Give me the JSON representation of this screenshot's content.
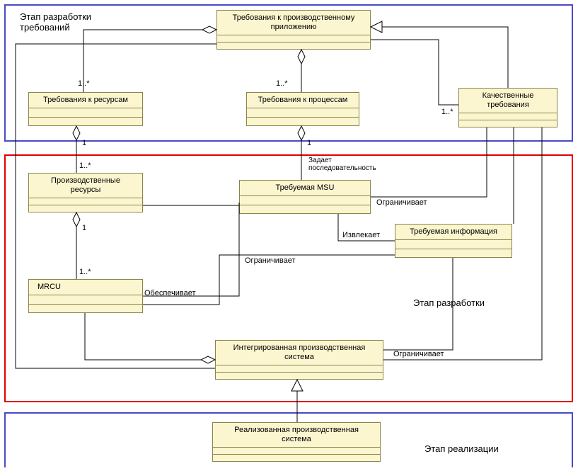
{
  "frames": {
    "requirements": {
      "title1": "Этап разработки",
      "title2": "требований"
    },
    "development": {
      "title": "Этап разработки"
    },
    "implementation": {
      "title": "Этап реализации"
    }
  },
  "classes": {
    "reqApp": {
      "title": "Требования к производственному\nприложению"
    },
    "reqRes": {
      "title": "Требования к ресурсам"
    },
    "reqProc": {
      "title": "Требования к процессам"
    },
    "qualReq": {
      "title": "Качественные\nтребования"
    },
    "prodRes": {
      "title": "Производственные\nресурсы"
    },
    "reqMSU": {
      "title": "Требуемая MSU"
    },
    "reqInfo": {
      "title": "Требуемая информация"
    },
    "mrcu": {
      "title": "MRCU"
    },
    "intSys": {
      "title": "Интегрированная производственная\nсистема"
    },
    "implSys": {
      "title": "Реализованная производственная\nсистема"
    }
  },
  "labels": {
    "m1": "1..*",
    "one": "1",
    "seq": "Задает\nпоследовательность",
    "restricts": "Ограничивает",
    "extracts": "Извлекает",
    "provides": "Обеспечивает"
  }
}
